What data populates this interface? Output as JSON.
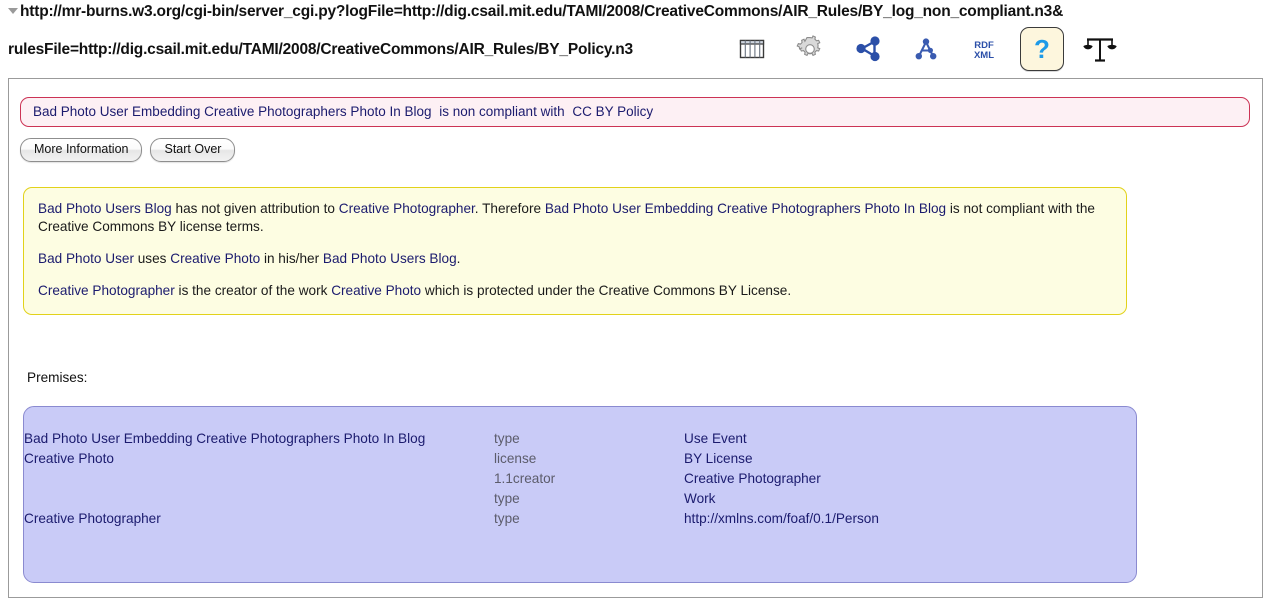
{
  "header": {
    "url_line1": "http://mr-burns.w3.org/cgi-bin/server_cgi.py?logFile=http://dig.csail.mit.edu/TAMI/2008/CreativeCommons/AIR_Rules/BY_log_non_compliant.n3&",
    "url_line2": "rulesFile=http://dig.csail.mit.edu/TAMI/2008/CreativeCommons/AIR_Rules/BY_Policy.n3"
  },
  "toolbar": {
    "items": [
      {
        "name": "table-view-icon",
        "title": "Table view",
        "selected": false
      },
      {
        "name": "gear-icon",
        "title": "Settings",
        "selected": false
      },
      {
        "name": "graph-share-icon",
        "title": "Graph view",
        "selected": false
      },
      {
        "name": "network-a-icon",
        "title": "Network view",
        "selected": false
      },
      {
        "name": "rdf-xml-icon",
        "title": "RDF/XML",
        "selected": false
      },
      {
        "name": "question-mark-icon",
        "title": "Why / Justify",
        "selected": true
      },
      {
        "name": "scales-icon",
        "title": "Compliance",
        "selected": false
      }
    ]
  },
  "conclusion": {
    "subject": "Bad Photo User Embedding Creative Photographers Photo In Blog",
    "predicate": "is  non compliant with",
    "object": "CC BY Policy"
  },
  "buttons": {
    "more_information": "More Information",
    "start_over": "Start Over"
  },
  "explanation": {
    "paragraph1": [
      {
        "text": "Bad Photo Users Blog",
        "entity": true
      },
      {
        "text": " has not given attribution to ",
        "entity": false
      },
      {
        "text": "Creative Photographer",
        "entity": true
      },
      {
        "text": ". Therefore ",
        "entity": false
      },
      {
        "text": "Bad Photo User Embedding Creative Photographers Photo In Blog",
        "entity": true
      },
      {
        "text": " is not compliant with the Creative Commons BY license terms.",
        "entity": false
      }
    ],
    "paragraph2": [
      {
        "text": "Bad Photo User",
        "entity": true
      },
      {
        "text": " uses ",
        "entity": false
      },
      {
        "text": "Creative Photo",
        "entity": true
      },
      {
        "text": " in his/her ",
        "entity": false
      },
      {
        "text": "Bad Photo Users Blog",
        "entity": true
      },
      {
        "text": ".",
        "entity": false
      }
    ],
    "paragraph3": [
      {
        "text": "Creative Photographer",
        "entity": true
      },
      {
        "text": " is the creator of the work ",
        "entity": false
      },
      {
        "text": "Creative Photo",
        "entity": true
      },
      {
        "text": " which is protected under the Creative Commons BY License.",
        "entity": false
      }
    ]
  },
  "premises_label": "Premises:",
  "premises": {
    "rows": [
      {
        "subject": "Bad Photo User Embedding Creative Photographers Photo In Blog",
        "predicate": "type",
        "object": "Use Event"
      },
      {
        "subject": "Creative Photo",
        "predicate": "license",
        "object": "BY License"
      },
      {
        "subject": "",
        "predicate": "1.1creator",
        "object": "Creative Photographer"
      },
      {
        "subject": "",
        "predicate": "type",
        "object": "Work"
      },
      {
        "subject": "Creative Photographer",
        "predicate": "type",
        "object": "http://xmlns.com/foaf/0.1/Person"
      }
    ]
  },
  "colors": {
    "entity_blue": "#1b1b6e",
    "predicate_gray": "#5c5c6b",
    "alert_border": "#cc3355",
    "alert_bg": "#fdf0f4",
    "explanation_border": "#e2d21a",
    "explanation_bg": "#fdfde2",
    "premises_border": "#8a8ad0",
    "premises_bg": "#c9cbf7",
    "selected_tool_bg": "#fdf6dd"
  }
}
